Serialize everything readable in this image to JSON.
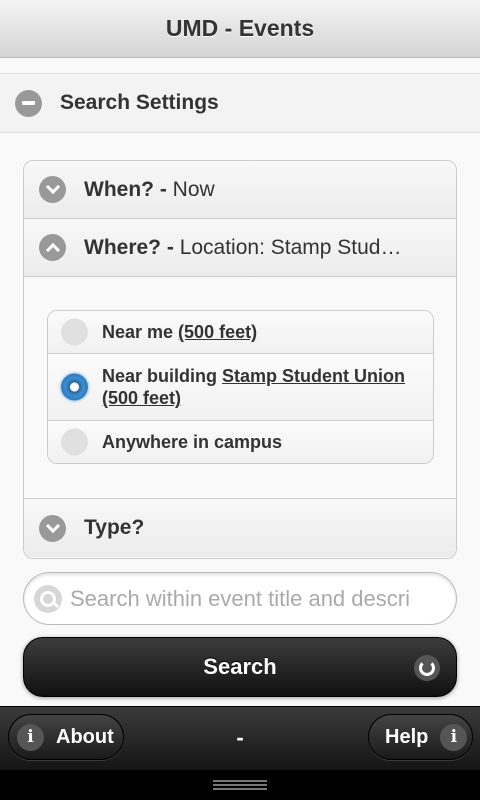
{
  "header": {
    "title": "UMD - Events"
  },
  "search_settings": {
    "label": "Search Settings"
  },
  "filters": {
    "when": {
      "label": "When? -",
      "value": "Now"
    },
    "where": {
      "label": "Where? -",
      "value": "Location: Stamp Stud…",
      "options": [
        {
          "text": "Near me ",
          "link": "(500 feet)",
          "selected": false
        },
        {
          "text": "Near building ",
          "link": "Stamp Student Union",
          "link2": "(500 feet)",
          "selected": true
        },
        {
          "text": "Anywhere in campus",
          "selected": false
        }
      ]
    },
    "type": {
      "label": "Type?"
    }
  },
  "search": {
    "placeholder": "Search within event title and description",
    "button_label": "Search"
  },
  "footer": {
    "about_label": "About",
    "center_text": "-",
    "help_label": "Help"
  }
}
